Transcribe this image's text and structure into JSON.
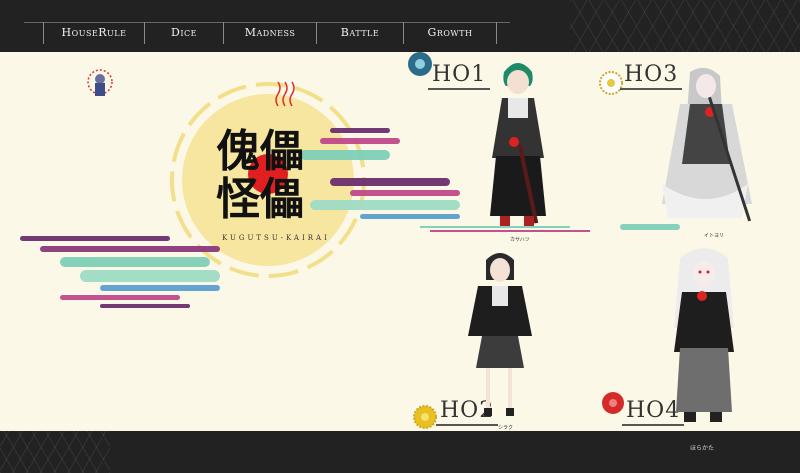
{
  "nav": {
    "items": [
      {
        "label": "HouseRule"
      },
      {
        "label": "Dice"
      },
      {
        "label": "Madness"
      },
      {
        "label": "Battle"
      },
      {
        "label": "Growth"
      }
    ]
  },
  "logo": {
    "title_line1": "傀儡",
    "title_line2": "怪儡",
    "subtitle": "KUGUTSU-KAIRAI"
  },
  "characters": [
    {
      "ho": "HO1",
      "name": "カサハツ"
    },
    {
      "ho": "HO2",
      "name": "シラク"
    },
    {
      "ho": "HO3",
      "name": "イトヨリ"
    },
    {
      "ho": "HO4",
      "name": "ほらかた"
    }
  ],
  "footer": {
    "text": "ほらかた"
  },
  "colors": {
    "bar": "#222222",
    "background": "#fcf8e8",
    "accent_red": "#e02020",
    "accent_sun": "#f7e6a0"
  }
}
